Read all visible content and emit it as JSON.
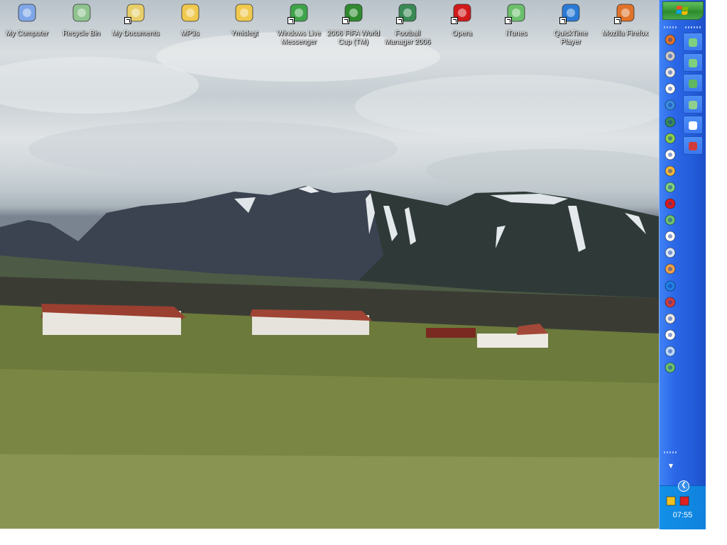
{
  "desktop": {
    "icons": [
      {
        "name": "my-computer-icon",
        "label": "My Computer",
        "shortcut": false,
        "color": "#7fa7e8"
      },
      {
        "name": "recycle-bin-icon",
        "label": "Recycle Bin",
        "shortcut": false,
        "color": "#8fc48f"
      },
      {
        "name": "my-documents-icon",
        "label": "My Documents",
        "shortcut": true,
        "color": "#e8cf6a"
      },
      {
        "name": "folder-icon",
        "label": "MP3s",
        "shortcut": false,
        "color": "#f0c94f"
      },
      {
        "name": "folder-icon",
        "label": "Ymislegt",
        "shortcut": false,
        "color": "#f0c94f"
      },
      {
        "name": "messenger-icon",
        "label": "Windows Live Messenger",
        "shortcut": true,
        "color": "#3fa34a"
      },
      {
        "name": "fifa-icon",
        "label": "2006 FIFA World Cup (TM)",
        "shortcut": true,
        "color": "#2f8a2f"
      },
      {
        "name": "football-manager-icon",
        "label": "Football Manager 2006",
        "shortcut": true,
        "color": "#3a8a55"
      },
      {
        "name": "opera-icon",
        "label": "Opera",
        "shortcut": true,
        "color": "#d21a1a"
      },
      {
        "name": "itunes-icon",
        "label": "iTunes",
        "shortcut": true,
        "color": "#6cbf6c"
      },
      {
        "name": "quicktime-icon",
        "label": "QuickTime Player",
        "shortcut": true,
        "color": "#2a7ad6"
      },
      {
        "name": "firefox-icon",
        "label": "Mozilla Firefox",
        "shortcut": true,
        "color": "#e0732a"
      }
    ]
  },
  "taskbar": {
    "start_icon": "windows-logo-icon",
    "quick_launch": [
      {
        "name": "firefox-icon",
        "color": "#e0732a"
      },
      {
        "name": "notepad-icon",
        "color": "#c9c9c9"
      },
      {
        "name": "document-icon",
        "color": "#e6e6e6"
      },
      {
        "name": "media-player-icon",
        "color": "#ffffff"
      },
      {
        "name": "internet-explorer-icon",
        "color": "#3a8de0"
      },
      {
        "name": "football-manager-icon",
        "color": "#3a8a55"
      },
      {
        "name": "winamp-icon",
        "color": "#8bd04a"
      },
      {
        "name": "speech-bubble-icon",
        "color": "#ffffff"
      },
      {
        "name": "pencil-icon",
        "color": "#f2b63a"
      },
      {
        "name": "network-icon",
        "color": "#7ed07e"
      },
      {
        "name": "k-icon",
        "color": "#e01919"
      },
      {
        "name": "messenger-icon",
        "color": "#6cc06c"
      },
      {
        "name": "notepad-icon",
        "color": "#ffffff"
      },
      {
        "name": "document-icon",
        "color": "#d8e4f8"
      },
      {
        "name": "paint-icon",
        "color": "#f0a04a"
      },
      {
        "name": "search-icon",
        "color": "#1f7fe8"
      },
      {
        "name": "realplayer-icon",
        "color": "#d23b3b"
      },
      {
        "name": "installer-icon",
        "color": "#e8e8e8"
      },
      {
        "name": "calendar-icon",
        "color": "#ffffff"
      },
      {
        "name": "globe-icon",
        "color": "#bcd8ff"
      },
      {
        "name": "messenger-icon",
        "color": "#6cc06c"
      }
    ],
    "tasks": [
      {
        "name": "messenger-icon",
        "color": "#7ed07e"
      },
      {
        "name": "messenger-icon",
        "color": "#7ed07e"
      },
      {
        "name": "picture-icon",
        "color": "#5fb85f"
      },
      {
        "name": "network-icon",
        "color": "#8fd08f"
      },
      {
        "name": "calculator-icon",
        "color": "#ffffff"
      },
      {
        "name": "realplayer-icon",
        "color": "#d23b3b"
      }
    ],
    "tray": {
      "icons": [
        {
          "name": "security-icon",
          "color": "#f0c020"
        },
        {
          "name": "network-alert-icon",
          "color": "#e02020"
        }
      ],
      "clock": "07:55"
    }
  }
}
